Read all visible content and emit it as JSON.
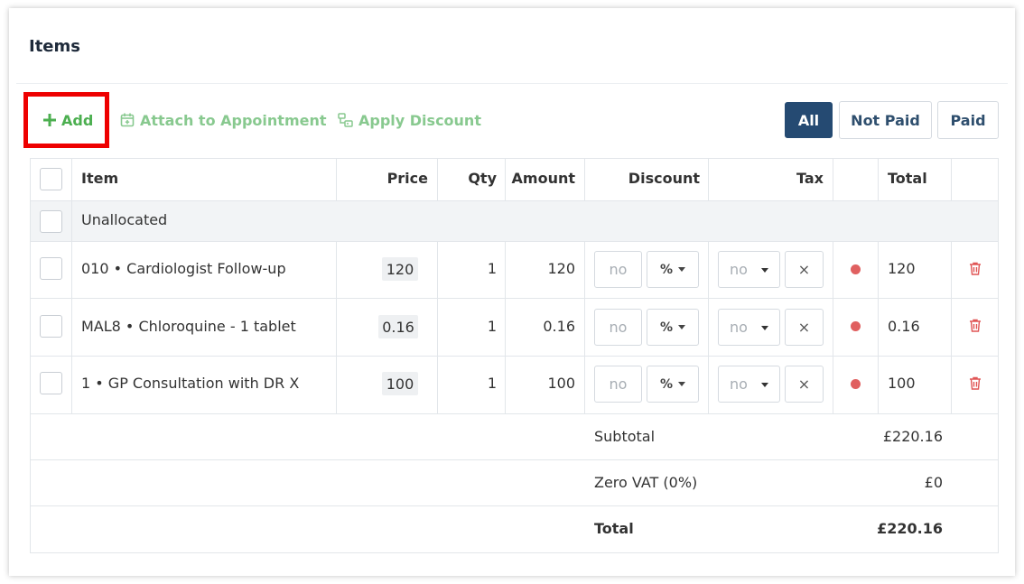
{
  "panel": {
    "title": "Items"
  },
  "toolbar": {
    "add_label": "Add",
    "attach_label": "Attach to Appointment",
    "discount_label": "Apply Discount"
  },
  "filters": {
    "all": "All",
    "not_paid": "Not Paid",
    "paid": "Paid",
    "selected": "All"
  },
  "table": {
    "headers": {
      "item": "Item",
      "price": "Price",
      "qty": "Qty",
      "amount": "Amount",
      "discount": "Discount",
      "tax": "Tax",
      "total": "Total"
    },
    "group_label": "Unallocated",
    "rows": [
      {
        "item": "010 • Cardiologist Follow-up",
        "price": "120",
        "qty": "1",
        "amount": "120",
        "discount_placeholder": "no",
        "discount_type": "%",
        "tax": "no",
        "clear": "×",
        "total": "120"
      },
      {
        "item": "MAL8 • Chloroquine - 1 tablet",
        "price": "0.16",
        "qty": "1",
        "amount": "0.16",
        "discount_placeholder": "no",
        "discount_type": "%",
        "tax": "no",
        "clear": "×",
        "total": "0.16"
      },
      {
        "item": "1 • GP Consultation with DR X",
        "price": "100",
        "qty": "1",
        "amount": "100",
        "discount_placeholder": "no",
        "discount_type": "%",
        "tax": "no",
        "clear": "×",
        "total": "100"
      }
    ],
    "summary": {
      "subtotal_label": "Subtotal",
      "subtotal_value": "£220.16",
      "vat_label": "Zero VAT (0%)",
      "vat_value": "£0",
      "total_label": "Total",
      "total_value": "£220.16"
    }
  },
  "colors": {
    "accent_add": "#4caf50",
    "selected_filter": "#254a72",
    "status_dot": "#e06060",
    "highlight": "#ee0000"
  },
  "icons": {
    "add": "plus-icon",
    "attach": "calendar-icon",
    "discount": "discount-icon",
    "delete": "trash-icon",
    "status": "status-dot-icon"
  }
}
